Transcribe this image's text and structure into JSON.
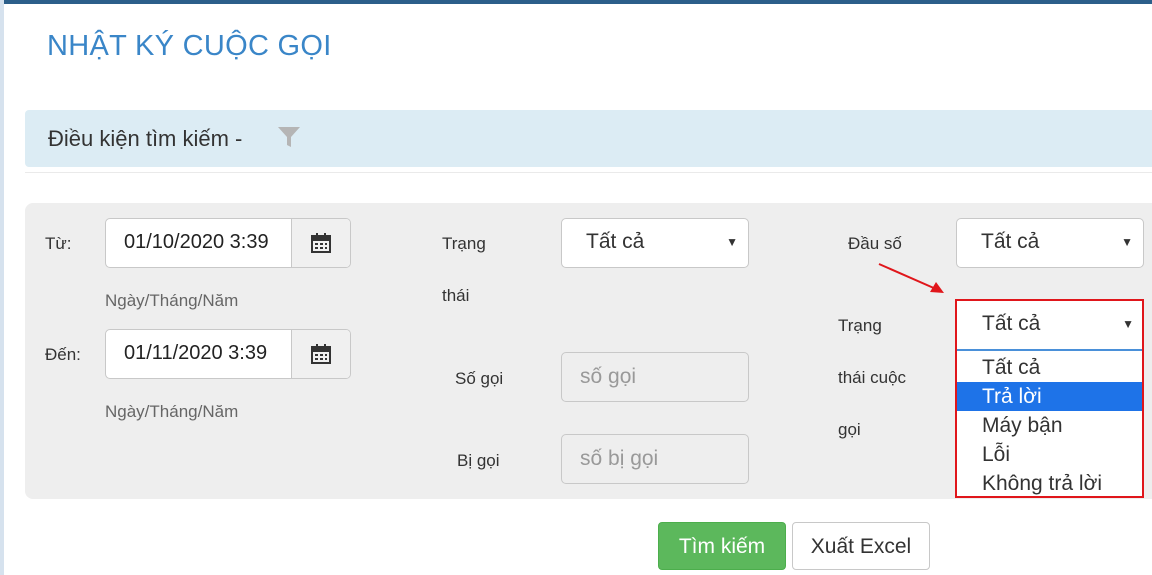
{
  "page": {
    "title": "NHẬT KÝ CUỘC GỌI"
  },
  "filter": {
    "header_label": "Điều kiện tìm kiếm -",
    "icon": "filter-funnel-icon"
  },
  "form": {
    "from": {
      "label": "Từ:",
      "value": "01/10/2020 3:39",
      "help": "Ngày/Tháng/Năm",
      "icon": "calendar-icon"
    },
    "to": {
      "label": "Đến:",
      "value": "01/11/2020 3:39",
      "help": "Ngày/Tháng/Năm",
      "icon": "calendar-icon"
    },
    "status": {
      "label_line1": "Trạng",
      "label_line2": "thái",
      "value": "Tất cả"
    },
    "caller": {
      "label": "Số gọi",
      "placeholder": "số gọi"
    },
    "callee": {
      "label": "Bị gọi",
      "placeholder": "số bị gọi"
    },
    "prefix": {
      "label": "Đầu số",
      "value": "Tất cả"
    },
    "call_status": {
      "label_line1": "Trạng",
      "label_line2": "thái cuộc",
      "label_line3": "gọi",
      "value": "Tất cả",
      "options": [
        "Tất cả",
        "Trả lời",
        "Máy bận",
        "Lỗi",
        "Không trả lời"
      ],
      "highlighted": "Trả lời"
    }
  },
  "buttons": {
    "search": "Tìm kiếm",
    "export": "Xuất Excel"
  },
  "colors": {
    "title": "#3a86c8",
    "highlight_box": "#e0161b",
    "active_option": "#1e73e8",
    "search_button": "#5cb85c"
  }
}
